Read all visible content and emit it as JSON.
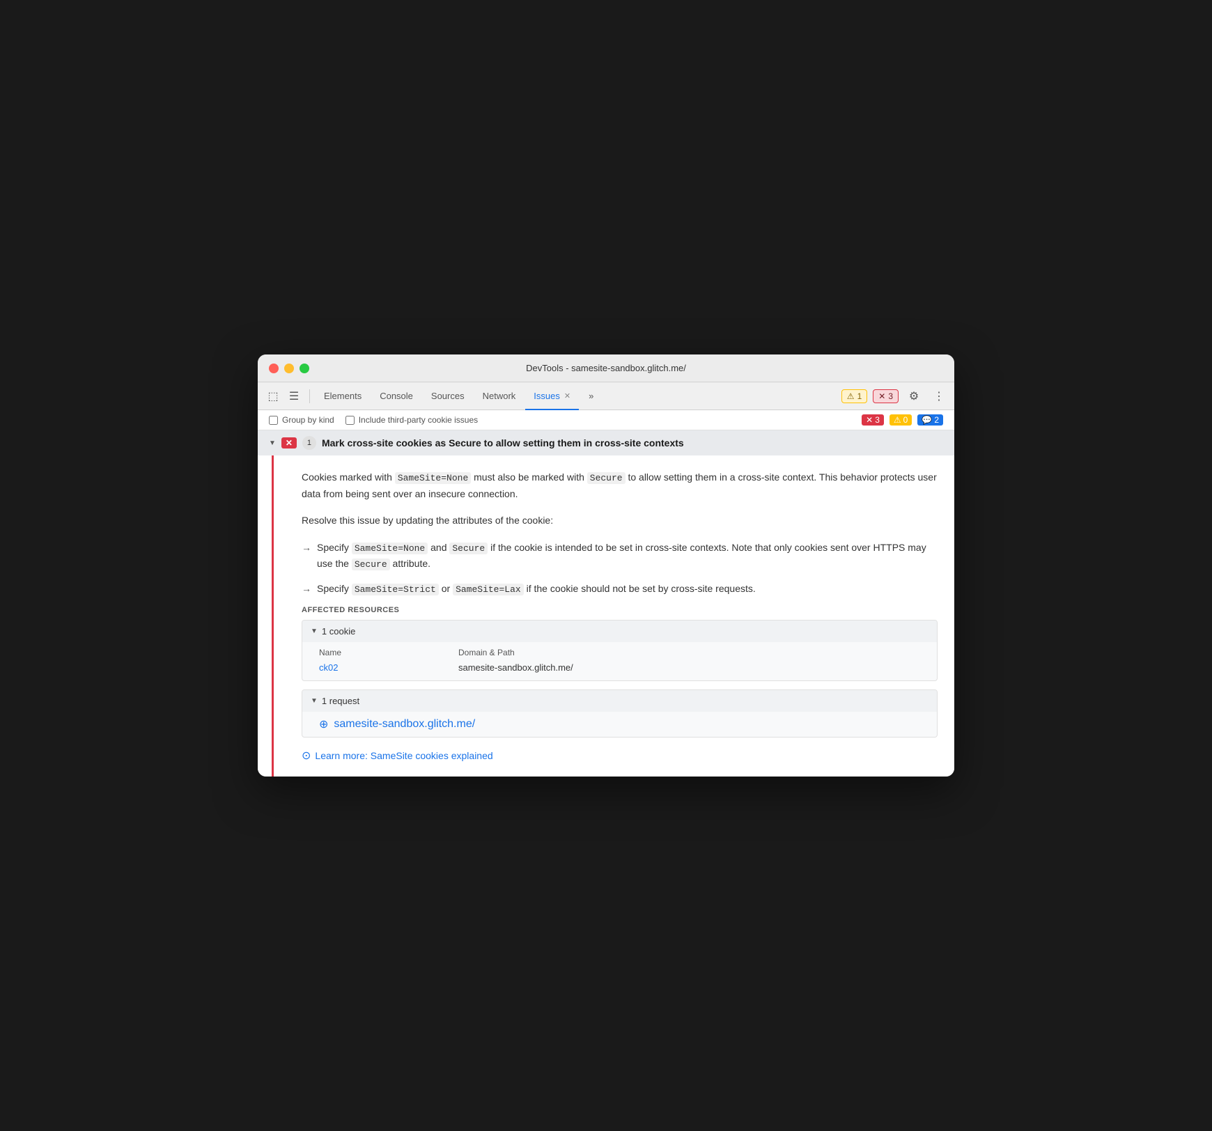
{
  "window": {
    "title": "DevTools - samesite-sandbox.glitch.me/"
  },
  "traffic_lights": {
    "red": "red",
    "yellow": "yellow",
    "green": "green"
  },
  "toolbar": {
    "tabs": [
      {
        "id": "elements",
        "label": "Elements",
        "active": false
      },
      {
        "id": "console",
        "label": "Console",
        "active": false
      },
      {
        "id": "sources",
        "label": "Sources",
        "active": false
      },
      {
        "id": "network",
        "label": "Network",
        "active": false
      },
      {
        "id": "issues",
        "label": "Issues",
        "active": true,
        "closeable": true
      }
    ],
    "more_tabs_label": "»",
    "badge_warning_count": "1",
    "badge_error_count": "3",
    "gear_icon": "⚙",
    "more_icon": "⋮"
  },
  "filters": {
    "group_by_kind_label": "Group by kind",
    "third_party_label": "Include third-party cookie issues",
    "error_count": "3",
    "warning_count": "0",
    "info_count": "2"
  },
  "issue": {
    "arrow": "▼",
    "badge_type": "✕",
    "count": "1",
    "title": "Mark cross-site cookies as Secure to allow setting them in cross-site contexts",
    "description_parts": [
      "Cookies marked with ",
      "SameSite=None",
      " must also be marked with ",
      "Secure",
      " to allow setting them in a cross-site context. This behavior protects user data from being sent over an insecure connection."
    ],
    "resolve_text": "Resolve this issue by updating the attributes of the cookie:",
    "bullets": [
      {
        "arrow": "→",
        "text_before": "Specify ",
        "code1": "SameSite=None",
        "text_mid1": " and ",
        "code2": "Secure",
        "text_after": " if the cookie is intended to be set in cross-site contexts. Note that only cookies sent over HTTPS may use the ",
        "code3": "Secure",
        "text_end": " attribute."
      },
      {
        "arrow": "→",
        "text_before": "Specify ",
        "code1": "SameSite=Strict",
        "text_mid1": " or ",
        "code2": "SameSite=Lax",
        "text_after": " if the cookie should not be set by cross-site requests."
      }
    ],
    "affected_label": "AFFECTED RESOURCES",
    "cookie_section": {
      "count_text": "1 cookie",
      "headers": [
        "Name",
        "Domain & Path"
      ],
      "rows": [
        {
          "name": "ck02",
          "domain": "samesite-sandbox.glitch.me/"
        }
      ]
    },
    "request_section": {
      "count_text": "1 request",
      "url": "samesite-sandbox.glitch.me/"
    },
    "learn_more": {
      "text": "Learn more: SameSite cookies explained"
    }
  }
}
